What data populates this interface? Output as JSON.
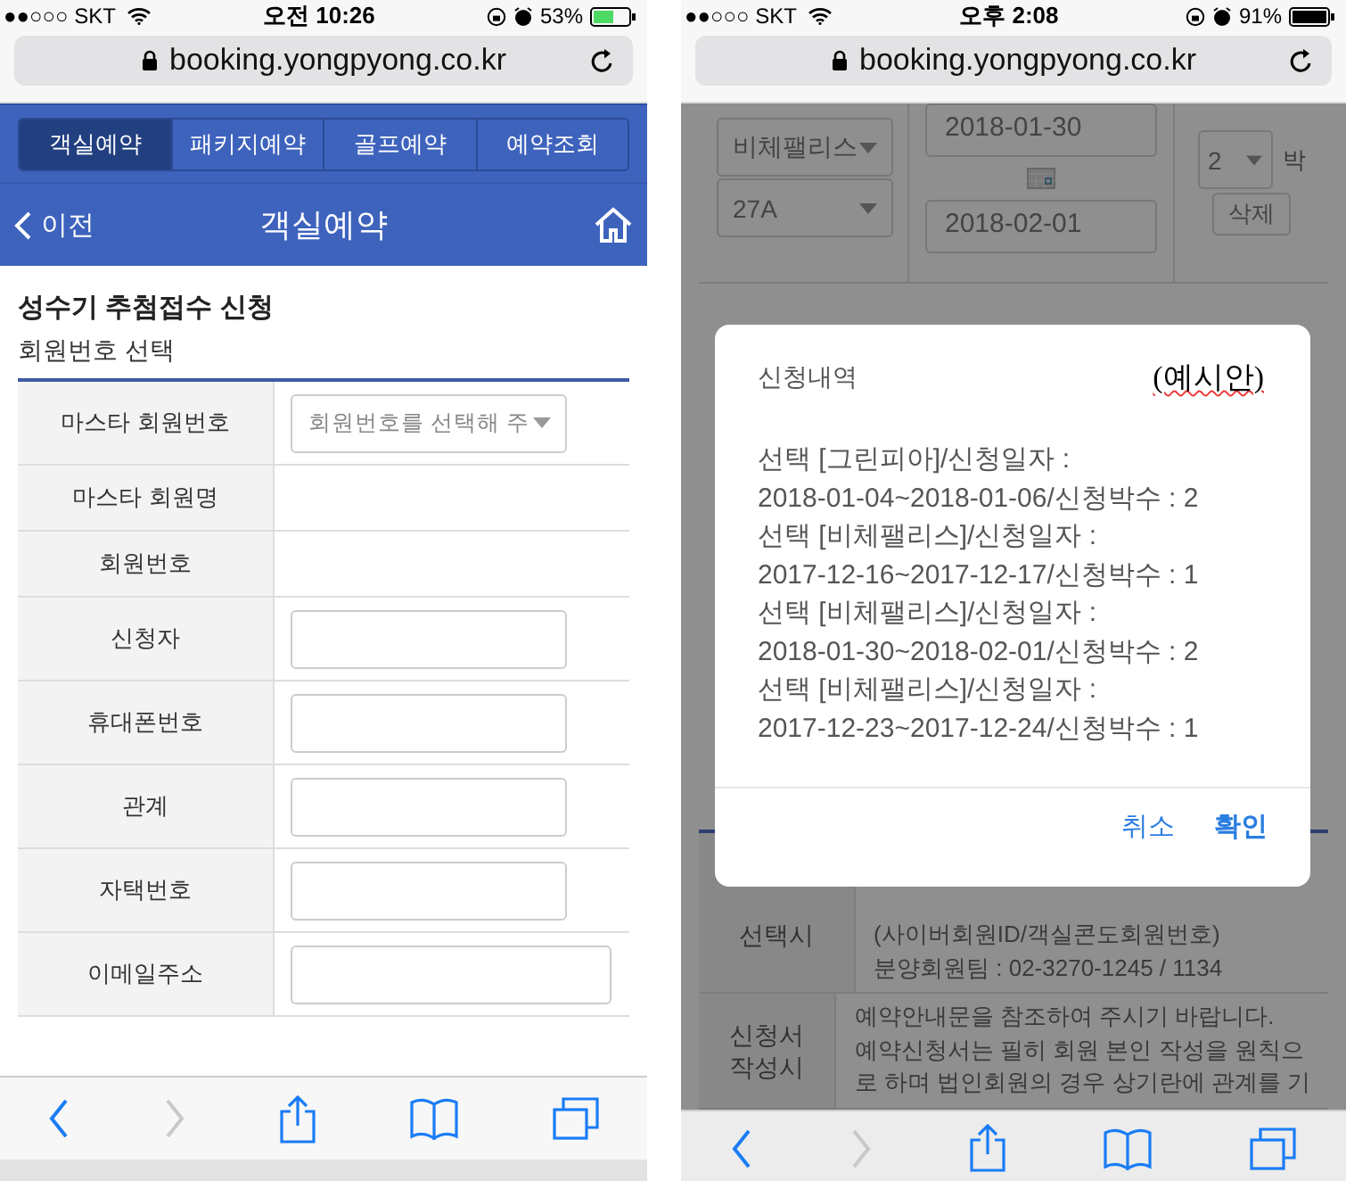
{
  "left_phone": {
    "status_bar": {
      "carrier": "●●○○○ SKT",
      "time": "오전 10:26",
      "battery": "53%"
    },
    "address_bar": {
      "url": "booking.yongpyong.co.kr"
    },
    "tabs": [
      {
        "label": "객실예약",
        "selected": true
      },
      {
        "label": "패키지예약",
        "selected": false
      },
      {
        "label": "골프예약",
        "selected": false
      },
      {
        "label": "예약조회",
        "selected": false
      }
    ],
    "nav_bar": {
      "back": "이전",
      "title": "객실예약"
    },
    "section_title": "성수기 추첨접수 신청",
    "subsection_title": "회원번호 선택",
    "form_rows": [
      {
        "label": "마스타 회원번호",
        "kind": "select",
        "placeholder": "회원번호를 선택해 주"
      },
      {
        "label": "마스타 회원명",
        "kind": "text"
      },
      {
        "label": "회원번호",
        "kind": "text"
      },
      {
        "label": "신청자",
        "kind": "input",
        "wide": false
      },
      {
        "label": "휴대폰번호",
        "kind": "input",
        "wide": false
      },
      {
        "label": "관계",
        "kind": "input",
        "wide": false
      },
      {
        "label": "자택번호",
        "kind": "input",
        "wide": false
      },
      {
        "label": "이메일주소",
        "kind": "input",
        "wide": true
      }
    ]
  },
  "right_phone": {
    "status_bar": {
      "carrier": "●●○○○ SKT",
      "time": "오후 2:08",
      "battery": "91%"
    },
    "address_bar": {
      "url": "booking.yongpyong.co.kr"
    },
    "booking_row": {
      "property": "비체팰리스",
      "room": "27A",
      "check_in": "2018-01-30",
      "check_out": "2018-02-01",
      "nights": "2",
      "nights_unit": "박",
      "delete": "삭제"
    },
    "info_rows": [
      {
        "label": "선택시",
        "lines": [
          "(사이버회원ID/객실콘도회원번호)",
          "분양회원팀 : 02-3270-1245 / 1134"
        ]
      },
      {
        "label": "신청서 작성시",
        "lines": [
          "예약안내문을 참조하여 주시기 바랍니다.",
          "예약신청서는 필히 회원 본인 작성을 원칙으",
          "로 하며 법인회원의 경우 상기란에 관계를 기"
        ]
      }
    ],
    "dialog": {
      "title": "신청내역",
      "note": "(예시안)",
      "lines": [
        "선택 [그린피아]/신청일자 :",
        "2018-01-04~2018-01-06/신청박수 : 2",
        "선택 [비체팰리스]/신청일자 :",
        "2017-12-16~2017-12-17/신청박수 : 1",
        "선택 [비체팰리스]/신청일자 :",
        "2018-01-30~2018-02-01/신청박수 : 2",
        "선택 [비체팰리스]/신청일자 :",
        "2017-12-23~2017-12-24/신청박수 : 1"
      ],
      "buttons": [
        {
          "label": "취소",
          "kind": "cancel"
        },
        {
          "label": "확인",
          "kind": "confirm"
        }
      ]
    }
  }
}
